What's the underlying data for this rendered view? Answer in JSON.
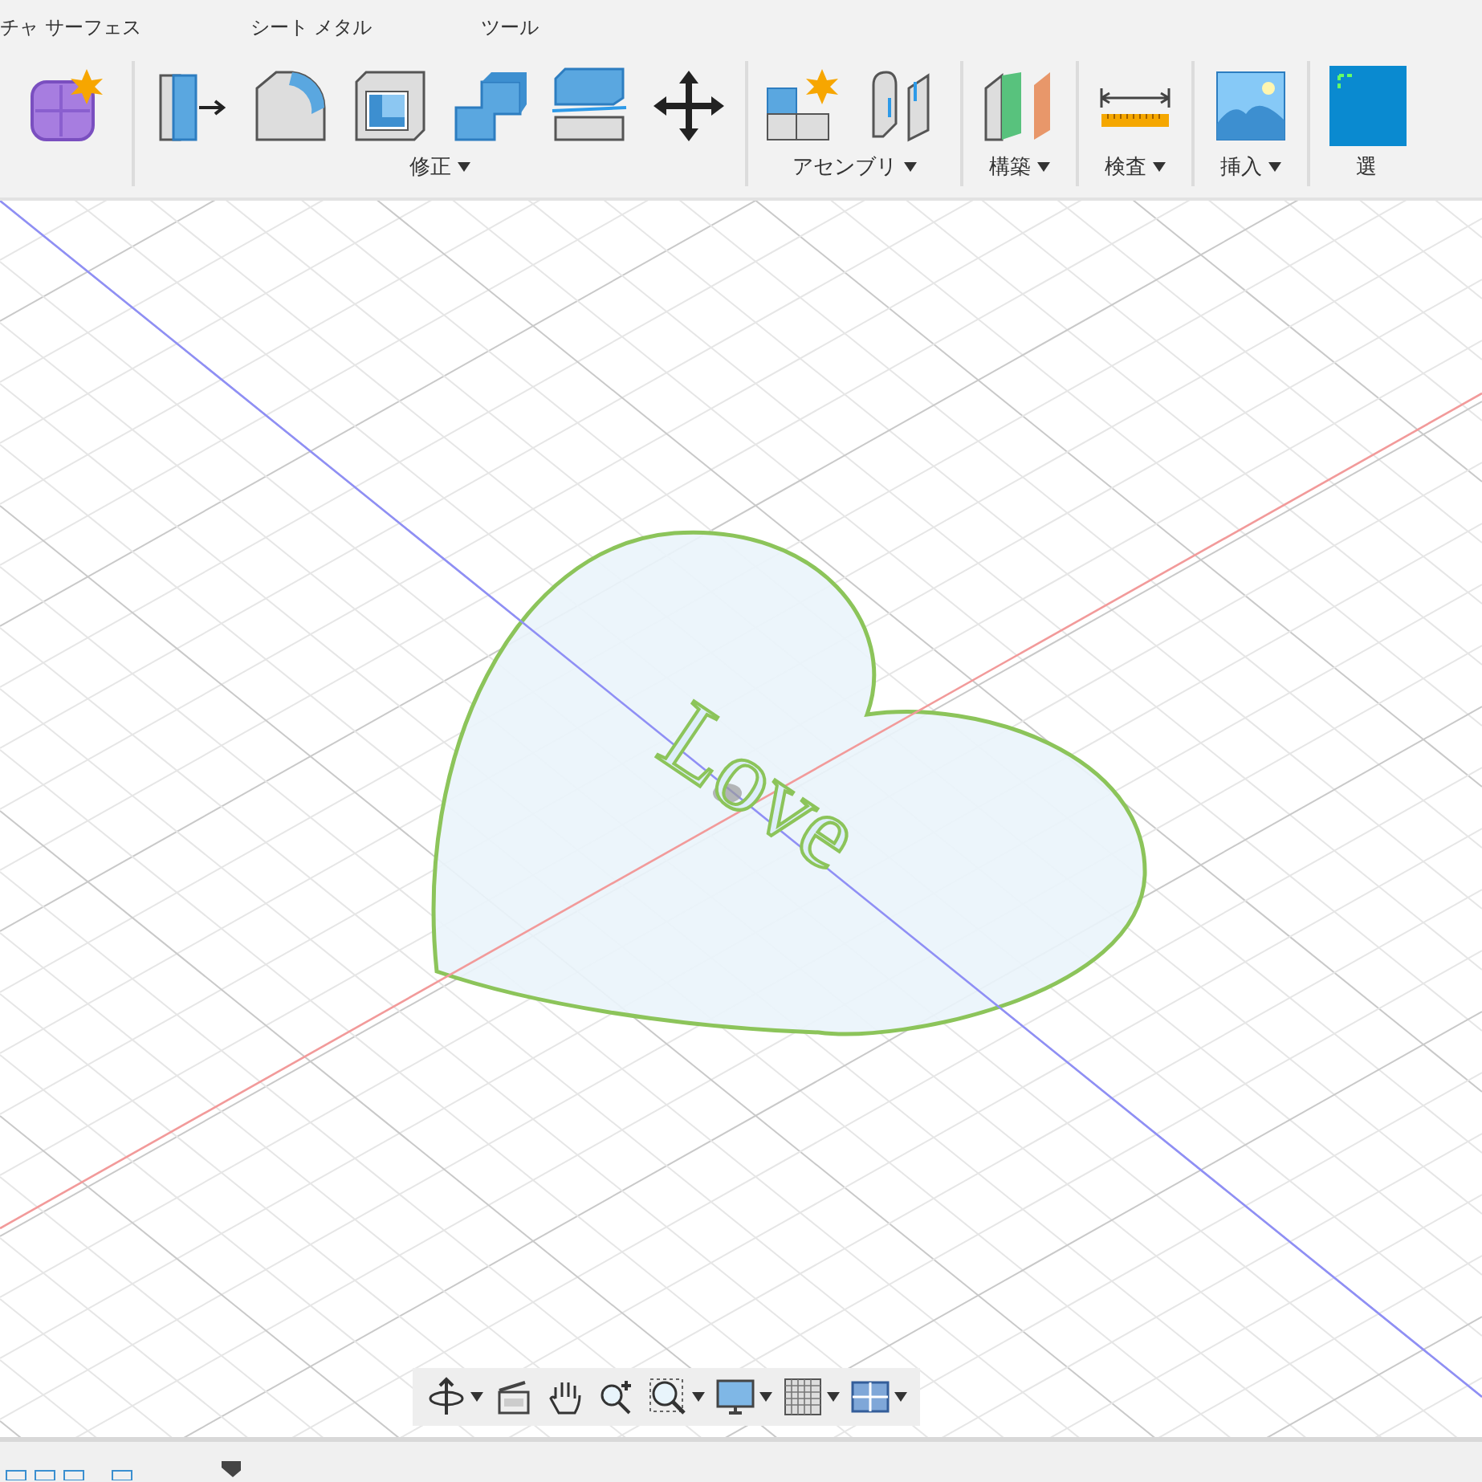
{
  "toolbar": {
    "tabs": [
      {
        "label": "チャ サーフェス"
      },
      {
        "label": "シート メタル"
      },
      {
        "label": "ツール"
      }
    ],
    "groups": [
      {
        "tools": [
          {
            "kind": "new-component"
          }
        ]
      },
      {
        "label": "修正",
        "tools": [
          {
            "kind": "press-pull"
          },
          {
            "kind": "fillet"
          },
          {
            "kind": "shell"
          },
          {
            "kind": "combine"
          },
          {
            "kind": "split"
          },
          {
            "kind": "move"
          }
        ]
      },
      {
        "label": "アセンブリ",
        "tools": [
          {
            "kind": "new-assembly"
          },
          {
            "kind": "joint"
          }
        ]
      },
      {
        "label": "構築",
        "tools": [
          {
            "kind": "plane"
          }
        ]
      },
      {
        "label": "検査",
        "tools": [
          {
            "kind": "measure"
          }
        ]
      },
      {
        "label": "挿入",
        "tools": [
          {
            "kind": "image"
          }
        ]
      },
      {
        "label": "選",
        "tools": [
          {
            "kind": "select"
          }
        ]
      }
    ]
  },
  "viewport": {
    "sketch_text": "Love"
  },
  "nav_bar": [
    {
      "kind": "orbit",
      "dropdown": true
    },
    {
      "kind": "look-at",
      "dropdown": false
    },
    {
      "kind": "pan",
      "dropdown": false
    },
    {
      "kind": "zoom",
      "dropdown": false
    },
    {
      "kind": "fit",
      "dropdown": true
    },
    {
      "kind": "display",
      "dropdown": true
    },
    {
      "kind": "grid",
      "dropdown": true
    },
    {
      "kind": "viewports",
      "dropdown": true
    }
  ]
}
